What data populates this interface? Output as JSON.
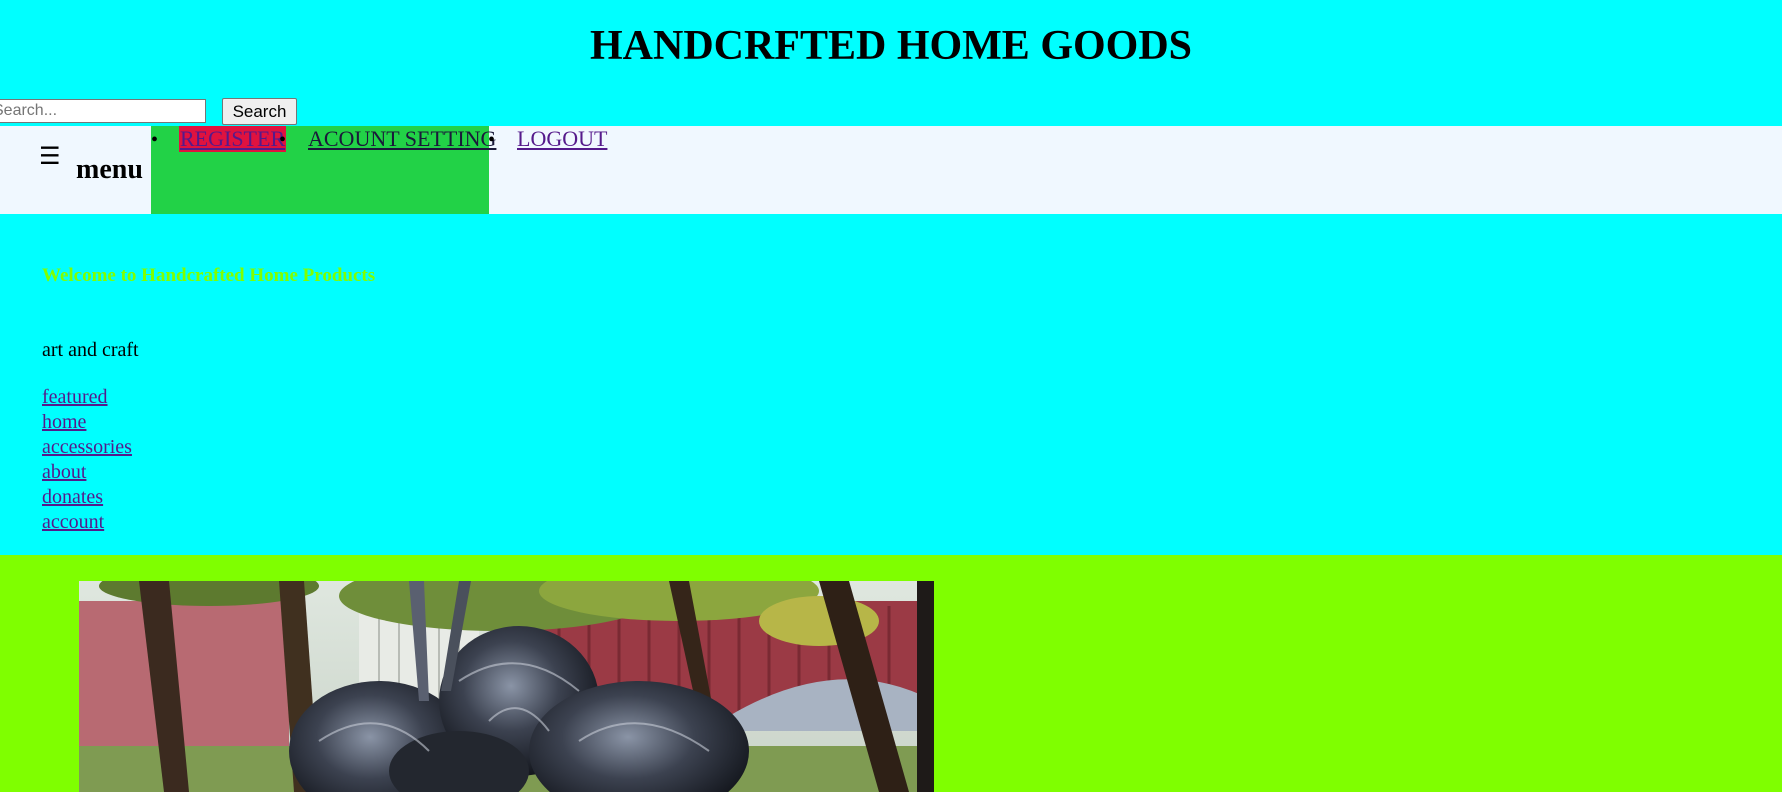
{
  "header": {
    "title": "HANDCRFTED HOME GOODS",
    "search_placeholder": "Search...",
    "search_button": "Search"
  },
  "navbar": {
    "hamburger_icon": "☰",
    "menu_label": "menu",
    "bullet": "•",
    "links": [
      {
        "label": "REGISTER"
      },
      {
        "label": "ACOUNT SETTING"
      },
      {
        "label": "LOGOUT"
      }
    ]
  },
  "main": {
    "welcome": "Welcome to Handcrafted Home Products",
    "tagline": "art and craft",
    "links": [
      {
        "label": "featured"
      },
      {
        "label": "home"
      },
      {
        "label": "accessories"
      },
      {
        "label": "about"
      },
      {
        "label": "donates"
      },
      {
        "label": "account"
      }
    ]
  },
  "colors": {
    "header_bg": "#00ffff",
    "navbar_bg": "#f0f8ff",
    "nav_highlight": "#22d247",
    "register_bg": "#e0123f",
    "welcome_text": "#7fff00",
    "image_section_bg": "#7fff00"
  },
  "hero": {
    "icon": "metal-sculpture-photo"
  }
}
